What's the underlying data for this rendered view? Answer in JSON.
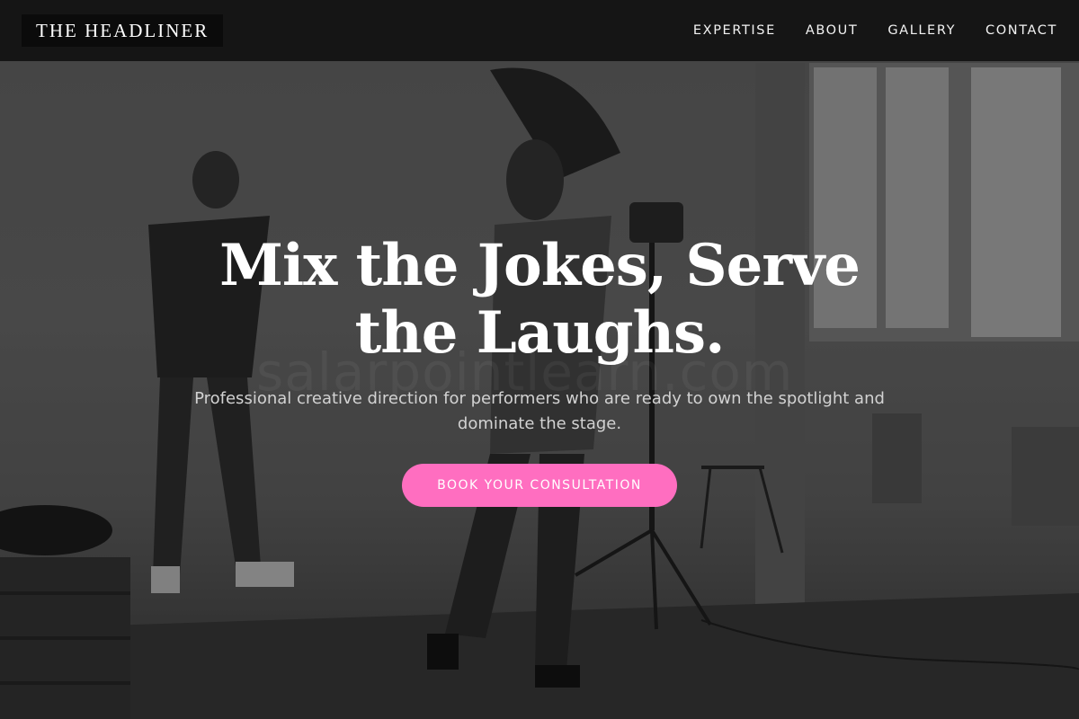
{
  "brand": {
    "name": "THE HEADLINER"
  },
  "nav": {
    "items": [
      {
        "label": "EXPERTISE"
      },
      {
        "label": "ABOUT"
      },
      {
        "label": "GALLERY"
      },
      {
        "label": "CONTACT"
      }
    ]
  },
  "hero": {
    "headline": "Mix the Jokes, Serve the Laughs.",
    "subtitle": "Professional creative direction for performers who are ready to own the spotlight and dominate the stage.",
    "cta_label": "BOOK YOUR CONSULTATION"
  },
  "background": {
    "description_icon": "photo-studio-background",
    "watermark_text": "salarpointlearn.com"
  },
  "colors": {
    "accent": "#ff6ec0",
    "nav_bg": "#121212",
    "text_light": "#ffffff"
  }
}
